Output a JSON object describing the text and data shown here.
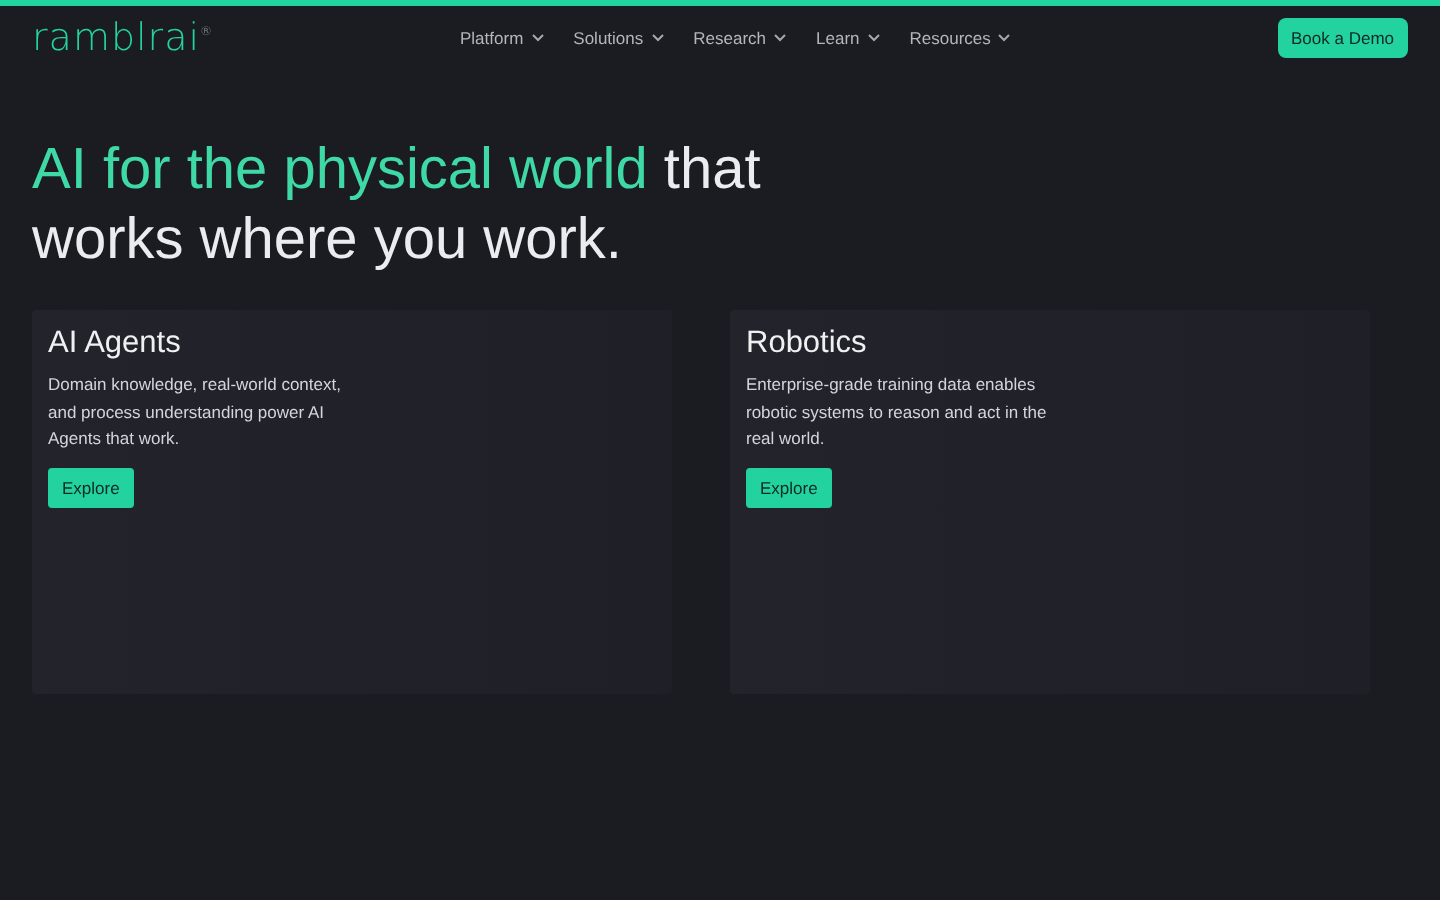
{
  "logo": {
    "text": "ramblrai",
    "mark": "®"
  },
  "nav": [
    {
      "label": "Platform"
    },
    {
      "label": "Solutions"
    },
    {
      "label": "Research"
    },
    {
      "label": "Learn"
    },
    {
      "label": "Resources"
    }
  ],
  "cta": "Book a Demo",
  "headline": {
    "accent": "AI for the physical world",
    "rest": "that works where you work."
  },
  "cards": [
    {
      "title": "AI Agents",
      "text": "Domain knowledge, real-world context, and process understanding power AI Agents that work.",
      "button": "Explore"
    },
    {
      "title": "Robotics",
      "text": "Enterprise-grade training data enables robotic systems to reason and act in the real world.",
      "button": "Explore"
    }
  ]
}
